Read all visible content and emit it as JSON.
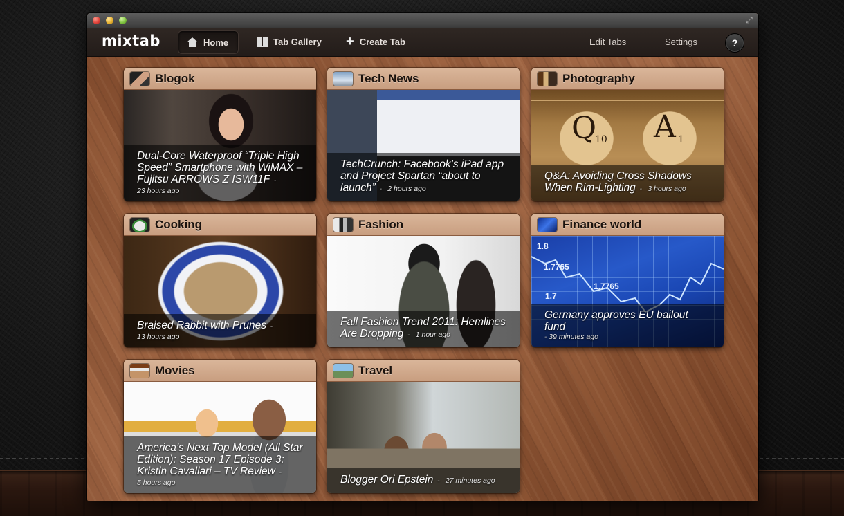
{
  "app": {
    "logo": "mixtab"
  },
  "nav": {
    "home_label": "Home",
    "gallery_label": "Tab Gallery",
    "create_label": "Create Tab",
    "edit_label": "Edit Tabs",
    "settings_label": "Settings",
    "help_label": "?"
  },
  "cards": [
    {
      "title": "Blogok",
      "headline": "Dual-Core Waterproof “Triple High Speed” Smartphone with WiMAX – Fujitsu ARROWS Z ISW11F",
      "time": "23 hours ago"
    },
    {
      "title": "Tech News",
      "headline": "TechCrunch: Facebook’s iPad app and Project Spartan “about to launch”",
      "time": "2 hours ago"
    },
    {
      "title": "Photography",
      "headline": "Q&A: Avoiding Cross Shadows When Rim-Lighting",
      "time": "3 hours ago"
    },
    {
      "title": "Cooking",
      "headline": "Braised Rabbit with Prunes",
      "time": "13 hours ago"
    },
    {
      "title": "Fashion",
      "headline": "Fall Fashion Trend 2011: Hemlines Are Dropping",
      "time": "1 hour ago"
    },
    {
      "title": "Finance world",
      "headline": "Germany approves EU bailout fund",
      "time": "39 minutes ago"
    },
    {
      "title": "Movies",
      "headline": "America’s Next Top Model (All Star Edition): Season 17 Episode 3: Kristin Cavallari – TV Review",
      "time": "5 hours ago"
    },
    {
      "title": "Travel",
      "headline": "Blogger Ori Epstein",
      "time": "27 minutes ago"
    }
  ],
  "photo_tiles": {
    "q": "Q",
    "q_sub": "10",
    "a": "A",
    "a_sub": "1"
  },
  "finance_numbers": [
    "1.8",
    "1.7765",
    "1.7765",
    "1.7"
  ],
  "icons": {
    "home": "home-icon",
    "gallery": "grid-icon",
    "create": "plus-icon",
    "help": "help-icon"
  }
}
